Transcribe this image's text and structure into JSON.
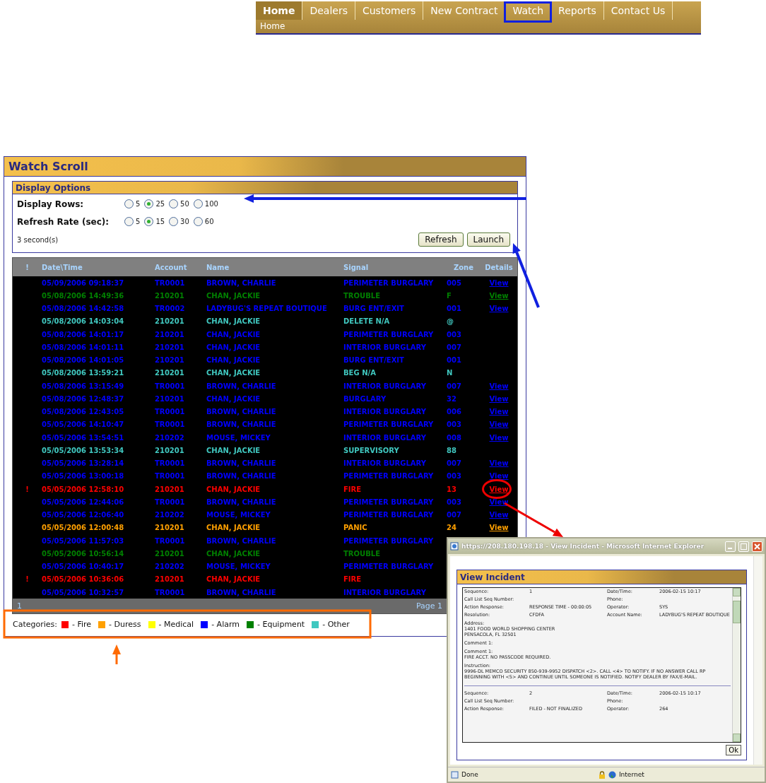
{
  "nav": {
    "tabs": [
      {
        "label": "Home",
        "selected": true,
        "highlighted": false
      },
      {
        "label": "Dealers",
        "selected": false,
        "highlighted": false
      },
      {
        "label": "Customers",
        "selected": false,
        "highlighted": false
      },
      {
        "label": "New Contract",
        "selected": false,
        "highlighted": false
      },
      {
        "label": "Watch",
        "selected": false,
        "highlighted": true
      },
      {
        "label": "Reports",
        "selected": false,
        "highlighted": false
      },
      {
        "label": "Contact Us",
        "selected": false,
        "highlighted": false
      }
    ],
    "breadcrumb": "Home"
  },
  "panel": {
    "title": "Watch Scroll",
    "display_options": {
      "title": "Display Options",
      "groups": [
        {
          "label": "Display Rows:",
          "options": [
            {
              "label": "5",
              "selected": false
            },
            {
              "label": "25",
              "selected": true
            },
            {
              "label": "50",
              "selected": false
            },
            {
              "label": "100",
              "selected": false
            }
          ]
        },
        {
          "label": "Refresh Rate (sec):",
          "options": [
            {
              "label": "5",
              "selected": false
            },
            {
              "label": "15",
              "selected": true
            },
            {
              "label": "30",
              "selected": false
            },
            {
              "label": "60",
              "selected": false
            }
          ]
        }
      ],
      "status": "3 second(s)",
      "buttons": [
        "Refresh",
        "Launch"
      ]
    },
    "table": {
      "columns": [
        "!",
        "Date\\Time",
        "Account",
        "Name",
        "Signal",
        "Zone",
        "Details"
      ],
      "rows": [
        {
          "color": "#0000ff",
          "date": "05/09/2006 09:18:37",
          "account": "TR0001",
          "name": "BROWN, CHARLIE",
          "signal": "PERIMETER BURGLARY",
          "zone": "005",
          "details": "View",
          "circled": false
        },
        {
          "color": "#008000",
          "date": "05/08/2006 14:49:36",
          "account": "210201",
          "name": "CHAN, JACKIE",
          "signal": "TROUBLE",
          "zone": "F",
          "details": "View",
          "circled": false
        },
        {
          "color": "#0000ff",
          "date": "05/08/2006 14:42:58",
          "account": "TR0002",
          "name": "LADYBUG'S REPEAT BOUTIQUE",
          "signal": "BURG ENT/EXIT",
          "zone": "001",
          "details": "View",
          "circled": false
        },
        {
          "color": "#40c8c0",
          "date": "05/08/2006 14:03:04",
          "account": "210201",
          "name": "CHAN, JACKIE",
          "signal": "DELETE N/A",
          "zone": "@",
          "circled": false
        },
        {
          "color": "#0000ff",
          "date": "05/08/2006 14:01:17",
          "account": "210201",
          "name": "CHAN, JACKIE",
          "signal": "PERIMETER BURGLARY",
          "zone": "003",
          "circled": false
        },
        {
          "color": "#0000ff",
          "date": "05/08/2006 14:01:11",
          "account": "210201",
          "name": "CHAN, JACKIE",
          "signal": "INTERIOR BURGLARY",
          "zone": "007",
          "circled": false
        },
        {
          "color": "#0000ff",
          "date": "05/08/2006 14:01:05",
          "account": "210201",
          "name": "CHAN, JACKIE",
          "signal": "BURG ENT/EXIT",
          "zone": "001",
          "circled": false
        },
        {
          "color": "#40c8c0",
          "date": "05/08/2006 13:59:21",
          "account": "210201",
          "name": "CHAN, JACKIE",
          "signal": "BEG N/A",
          "zone": "N",
          "circled": false
        },
        {
          "color": "#0000ff",
          "date": "05/08/2006 13:15:49",
          "account": "TR0001",
          "name": "BROWN, CHARLIE",
          "signal": "INTERIOR BURGLARY",
          "zone": "007",
          "details": "View",
          "circled": false
        },
        {
          "color": "#0000ff",
          "date": "05/08/2006 12:48:37",
          "account": "210201",
          "name": "CHAN, JACKIE",
          "signal": "BURGLARY",
          "zone": "32",
          "details": "View",
          "circled": false
        },
        {
          "color": "#0000ff",
          "date": "05/08/2006 12:43:05",
          "account": "TR0001",
          "name": "BROWN, CHARLIE",
          "signal": "INTERIOR BURGLARY",
          "zone": "006",
          "details": "View",
          "circled": false
        },
        {
          "color": "#0000ff",
          "date": "05/05/2006 14:10:47",
          "account": "TR0001",
          "name": "BROWN, CHARLIE",
          "signal": "PERIMETER BURGLARY",
          "zone": "003",
          "details": "View",
          "circled": false
        },
        {
          "color": "#0000ff",
          "date": "05/05/2006 13:54:51",
          "account": "210202",
          "name": "MOUSE, MICKEY",
          "signal": "INTERIOR BURGLARY",
          "zone": "008",
          "details": "View",
          "circled": false
        },
        {
          "color": "#40c8c0",
          "date": "05/05/2006 13:53:34",
          "account": "210201",
          "name": "CHAN, JACKIE",
          "signal": "SUPERVISORY",
          "zone": "88",
          "circled": false
        },
        {
          "color": "#0000ff",
          "date": "05/05/2006 13:28:14",
          "account": "TR0001",
          "name": "BROWN, CHARLIE",
          "signal": "INTERIOR BURGLARY",
          "zone": "007",
          "details": "View",
          "circled": false
        },
        {
          "color": "#0000ff",
          "date": "05/05/2006 13:00:18",
          "account": "TR0001",
          "name": "BROWN, CHARLIE",
          "signal": "PERIMETER BURGLARY",
          "zone": "003",
          "details": "View",
          "circled": false
        },
        {
          "color": "#ff0000",
          "alert": "!",
          "date": "05/05/2006 12:58:10",
          "account": "210201",
          "name": "CHAN, JACKIE",
          "signal": "FIRE",
          "zone": "13",
          "details": "View",
          "circled": true
        },
        {
          "color": "#0000ff",
          "date": "05/05/2006 12:44:06",
          "account": "TR0001",
          "name": "BROWN, CHARLIE",
          "signal": "PERIMETER BURGLARY",
          "zone": "003",
          "details": "View",
          "circled": false
        },
        {
          "color": "#0000ff",
          "date": "05/05/2006 12:06:40",
          "account": "210202",
          "name": "MOUSE, MICKEY",
          "signal": "PERIMETER BURGLARY",
          "zone": "007",
          "details": "View",
          "circled": false
        },
        {
          "color": "#ffa000",
          "date": "05/05/2006 12:00:48",
          "account": "210201",
          "name": "CHAN, JACKIE",
          "signal": "PANIC",
          "zone": "24",
          "details": "View",
          "circled": false
        },
        {
          "color": "#0000ff",
          "date": "05/05/2006 11:57:03",
          "account": "TR0001",
          "name": "BROWN, CHARLIE",
          "signal": "PERIMETER BURGLARY",
          "circled": false
        },
        {
          "color": "#008000",
          "date": "05/05/2006 10:56:14",
          "account": "210201",
          "name": "CHAN, JACKIE",
          "signal": "TROUBLE",
          "circled": false
        },
        {
          "color": "#0000ff",
          "date": "05/05/2006 10:40:17",
          "account": "210202",
          "name": "MOUSE, MICKEY",
          "signal": "PERIMETER BURGLARY",
          "circled": false
        },
        {
          "color": "#ff0000",
          "alert": "!",
          "date": "05/05/2006 10:36:06",
          "account": "210201",
          "name": "CHAN, JACKIE",
          "signal": "FIRE",
          "circled": false
        },
        {
          "color": "#0000ff",
          "date": "05/05/2006 10:32:57",
          "account": "TR0001",
          "name": "BROWN, CHARLIE",
          "signal": "INTERIOR BURGLARY",
          "circled": false
        }
      ],
      "pager": "1",
      "page": "Page 1"
    },
    "legend": {
      "label": "Categories:",
      "items": [
        {
          "color": "#ff0000",
          "label": "- Fire"
        },
        {
          "color": "#ffa000",
          "label": "- Duress"
        },
        {
          "color": "#ffff00",
          "label": "- Medical"
        },
        {
          "color": "#0000ff",
          "label": "- Alarm"
        },
        {
          "color": "#008000",
          "label": "- Equipment"
        },
        {
          "color": "#40c8c0",
          "label": "- Other"
        }
      ]
    }
  },
  "popup": {
    "window_title": "https://208.180.198.18 - View Incident - Microsoft Internet Explorer",
    "heading": "View Incident",
    "records": [
      {
        "fields": [
          {
            "label": "Sequence:",
            "value": "1"
          },
          {
            "label": "Date/Time:",
            "value": "2006-02-15 10:17"
          },
          {
            "label": "Call List Seq Number:"
          },
          {
            "label": "Phone:"
          },
          {
            "label": "Action Response:",
            "value": "RESPONSE TIME - 00:00:05"
          },
          {
            "label": "Operator:",
            "value": "SYS"
          },
          {
            "label": "Resolution:",
            "value": "CFDFA"
          },
          {
            "label": "Account Name:",
            "value": "LADYBUG'S REPEAT BOUTIQUE"
          }
        ],
        "blocks": [
          {
            "label": "Address:",
            "value": "1401 FOOD WORLD SHOPPING CENTER\nPENSACOLA, FL 32501"
          },
          {
            "label": "Comment 1:"
          },
          {
            "label": "Comment 1:",
            "value": "FIRE ACCT. NO PASSCODE REQUIRED."
          },
          {
            "label": "Instruction:",
            "value": "9996-DL MEMCO SECURITY 850-939-9952 DISPATCH <2>. CALL <4> TO NOTIFY. IF NO ANSWER CALL RP BEGINNING WITH <5> AND CONTINUE UNTIL SOMEONE IS NOTIFIED. NOTIFY DEALER BY FAX/E-MAIL."
          }
        ]
      },
      {
        "fields": [
          {
            "label": "Sequence:",
            "value": "2"
          },
          {
            "label": "Date/Time:",
            "value": "2006-02-15 10:17"
          },
          {
            "label": "Call List Seq Number:"
          },
          {
            "label": "Phone:"
          },
          {
            "label": "Action Response:",
            "value": "FILED - NOT FINALIZED"
          },
          {
            "label": "Operator:",
            "value": "264"
          }
        ]
      }
    ],
    "ok_button": "Ok",
    "status": "Done",
    "zone": "Internet"
  }
}
